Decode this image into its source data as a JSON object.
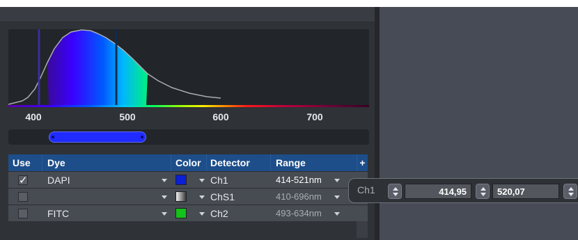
{
  "spectrum": {
    "axis_ticks": [
      "400",
      "500",
      "600",
      "700"
    ],
    "emission_range_nm": [
      414,
      521
    ]
  },
  "table": {
    "headers": {
      "use": "Use",
      "dye": "Dye",
      "color": "Color",
      "detector": "Detector",
      "range": "Range",
      "add": "+"
    },
    "rows": [
      {
        "use_checked": true,
        "use_mark": "✓",
        "dye": "DAPI",
        "color": "#0a1fd6",
        "detector": "Ch1",
        "range": "414-521nm",
        "range_active": true
      },
      {
        "use_checked": false,
        "use_mark": "",
        "dye": "",
        "color": "gradient-gray",
        "detector": "ChS1",
        "range": "410-696nm",
        "range_active": false
      },
      {
        "use_checked": false,
        "use_mark": "",
        "dye": "FITC",
        "color": "#13c21a",
        "detector": "Ch2",
        "range": "493-634nm",
        "range_active": false
      }
    ]
  },
  "range_popup": {
    "channel": "Ch1",
    "start_value": "414,95",
    "end_value": "520,07"
  },
  "colors": {
    "header_bg": "#1d4e8a",
    "panel_bg": "#2f3237",
    "accent_blue": "#1f2bff"
  }
}
